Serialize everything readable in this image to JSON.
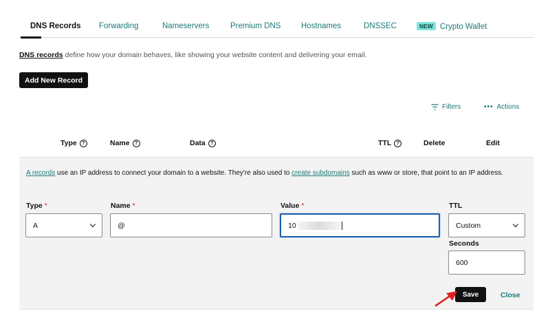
{
  "tabs": [
    {
      "label": "DNS Records",
      "active": true
    },
    {
      "label": "Forwarding"
    },
    {
      "label": "Nameservers"
    },
    {
      "label": "Premium DNS"
    },
    {
      "label": "Hostnames"
    },
    {
      "label": "DNSSEC"
    },
    {
      "label": "Crypto Wallet",
      "badge": "NEW"
    }
  ],
  "intro": {
    "link": "DNS records",
    "text": " define how your domain behaves, like showing your website content and delivering your email."
  },
  "add_button": "Add New Record",
  "toolbar": {
    "filters": "Filters",
    "actions": "Actions"
  },
  "columns": [
    "Type",
    "Name",
    "Data",
    "TTL",
    "Delete",
    "Edit"
  ],
  "panel": {
    "desc_link1": "A records",
    "desc_text1": " use an IP address to connect your domain to a website. They're also used to ",
    "desc_link2": "create subdomains",
    "desc_text2": " such as www or store, that point to an IP address.",
    "required_mark": "*",
    "type_label": "Type",
    "type_value": "A",
    "name_label": "Name",
    "name_value": "@",
    "value_label": "Value",
    "value_prefix": "10",
    "ttl_label": "TTL",
    "ttl_value": "Custom",
    "seconds_label": "Seconds",
    "seconds_value": "600",
    "save": "Save",
    "close": "Close"
  },
  "colors": {
    "accent": "#1a7a77",
    "focus": "#1b5fa8",
    "required": "#db1802",
    "arrow": "#e02020"
  }
}
